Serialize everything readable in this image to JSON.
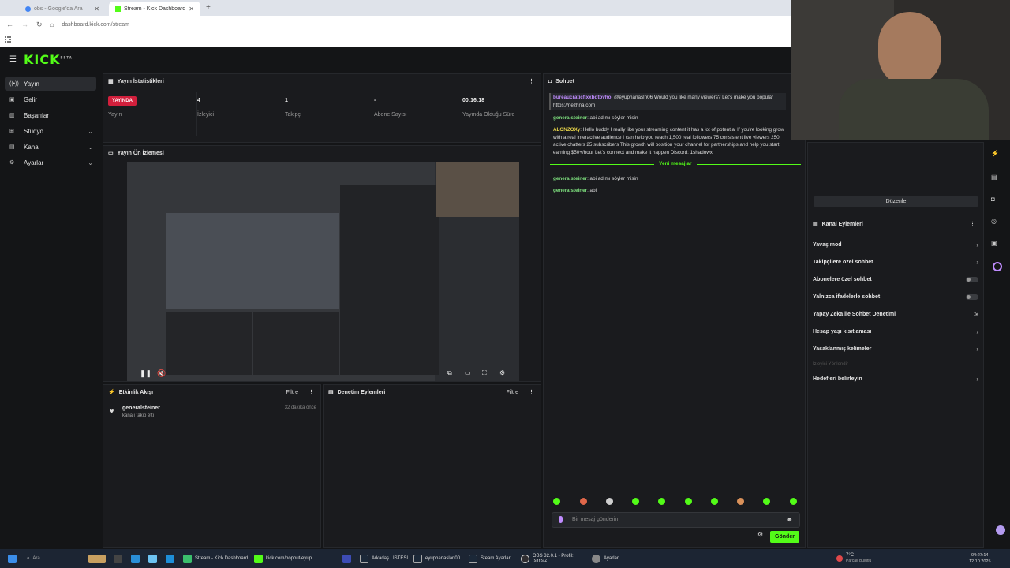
{
  "browser": {
    "tabs": [
      {
        "title": "obs - Google'da Ara"
      },
      {
        "title": "Stream - Kick Dashboard"
      }
    ],
    "url": "dashboard.kick.com/stream"
  },
  "header": {
    "logo": "KICK",
    "beta": "BETA"
  },
  "sidebar": {
    "items": [
      {
        "label": "Yayın"
      },
      {
        "label": "Gelir"
      },
      {
        "label": "Başarılar"
      },
      {
        "label": "Stüdyo"
      },
      {
        "label": "Kanal"
      },
      {
        "label": "Ayarlar"
      }
    ]
  },
  "stats": {
    "title": "Yayın İstatistikleri",
    "live_badge": "YAYINDA",
    "items": [
      {
        "value": "",
        "label": "Yayın"
      },
      {
        "value": "4",
        "label": "İzleyici"
      },
      {
        "value": "1",
        "label": "Takipçi"
      },
      {
        "value": "-",
        "label": "Abone Sayısı"
      },
      {
        "value": "00:16:18",
        "label": "Yayında Olduğu Süre"
      }
    ]
  },
  "preview": {
    "title": "Yayın Ön İzlemesi"
  },
  "activity": {
    "title": "Etkinlik Akışı",
    "filter": "Filtre",
    "events": [
      {
        "user": "generalsteiner",
        "action": "kanalı takip etti",
        "time": "32 dakika önce"
      }
    ]
  },
  "moderation": {
    "title": "Denetim Eylemleri",
    "filter": "Filtre"
  },
  "chat": {
    "title": "Sohbet",
    "messages": [
      {
        "user": "bureaucraticfixxbdtbvho",
        "text": ": @eyuphanasln06 Would you like many viewers? Let's make you popular https://nezhna.com"
      },
      {
        "user": "generalsteiner",
        "text": ": abi adımı söyler misin"
      },
      {
        "user": "ALONZOXy",
        "text": ": Hello buddy I really like your streaming content it has a lot of potential If you're looking grow with a real interactive audience I can help you reach 1,500 real followers 75 consistent live viewers 250 active chatters 25 subscribers This growth will position your channel for partnerships and help you start earning $50+/hour Let's connect and make it happen Discord: 1shadowx"
      },
      {
        "user": "generalsteiner",
        "text": ": abi adımı söyler misin"
      },
      {
        "user": "generalsteiner",
        "text": ": abi"
      }
    ],
    "new_messages": "Yeni mesajlar",
    "input_placeholder": "Bir mesaj gönderin",
    "send": "Gönder"
  },
  "channel_actions": {
    "edit": "Düzenle",
    "title": "Kanal Eylemleri",
    "items": [
      {
        "label": "Yavaş mod",
        "type": "arrow"
      },
      {
        "label": "Takipçilere özel sohbet",
        "type": "arrow"
      },
      {
        "label": "Abonelere özel sohbet",
        "type": "toggle"
      },
      {
        "label": "Yalnızca ifadelerle sohbet",
        "type": "toggle"
      },
      {
        "label": "Yapay Zeka ile Sohbet Denetimi",
        "type": "external"
      },
      {
        "label": "Hesap yaşı kısıtlaması",
        "type": "arrow"
      },
      {
        "label": "Yasaklanmış kelimeler",
        "type": "arrow"
      },
      {
        "label": "İzleyici Yönlendir",
        "type": "disabled"
      },
      {
        "label": "Hedefleri belirleyin",
        "type": "arrow"
      }
    ]
  },
  "taskbar": {
    "search": "Ara",
    "apps": [
      {
        "label": "Stream - Kick Dashboard"
      },
      {
        "label": "kick.com/popout/eyup..."
      },
      {
        "label": "Arkadaş LİSTESİ"
      },
      {
        "label": "eyuphanaslan00"
      },
      {
        "label": "Steam Ayarları"
      },
      {
        "label": "OBS 32.0.1 - Profil: İsimsiz"
      },
      {
        "label": "Ayarlar"
      }
    ],
    "weather": "7°C",
    "weather_sub": "Parçalı Bulutlu",
    "time": "04:27:14",
    "date": "12.10.2025"
  },
  "colors": {
    "accent": "#53fc18",
    "live": "#d21f3c",
    "bg": "#141517",
    "panel": "#1a1b1e"
  }
}
